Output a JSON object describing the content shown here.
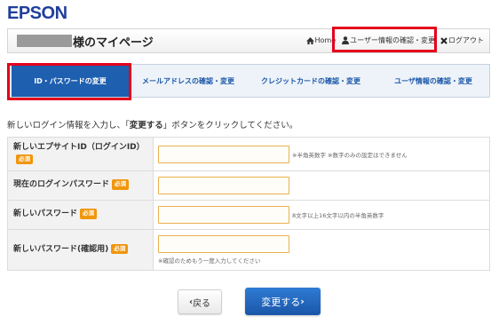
{
  "brand": {
    "logo": "EPSON"
  },
  "header": {
    "mypage_title": "様のマイページ",
    "links": {
      "home": "Home",
      "user_info": "ユーザー情報の確認・変更",
      "logout": "ログアウト"
    }
  },
  "tabs": [
    {
      "label": "ID・パスワードの変更",
      "active": true
    },
    {
      "label": "メールアドレスの確認・変更",
      "active": false
    },
    {
      "label": "クレジットカードの確認・変更",
      "active": false
    },
    {
      "label": "ユーザ情報の確認・変更",
      "active": false
    }
  ],
  "instruction": {
    "before": "新しいログイン情報を入力し、「",
    "emphasis": "変更する",
    "after": "」ボタンをクリックしてください。"
  },
  "form": {
    "required_badge": "必須",
    "rows": [
      {
        "label": "新しいエプサイトID（ログインID）",
        "value": "",
        "note": "※半角英数字 ※数字のみの設定はできません"
      },
      {
        "label": "現在のログインパスワード",
        "value": "",
        "note": ""
      },
      {
        "label": "新しいパスワード",
        "value": "",
        "note": "8文字以上16文字以内の半角英数字"
      },
      {
        "label": "新しいパスワード(確認用)",
        "value": "",
        "note": "※確認のためもう一度入力してください"
      }
    ]
  },
  "buttons": {
    "back": "戻る",
    "submit": "変更する"
  },
  "colors": {
    "brand": "#1f3f9a",
    "accent": "#1e5fb0",
    "highlight": "#e4001b",
    "required": "#f0960c"
  }
}
